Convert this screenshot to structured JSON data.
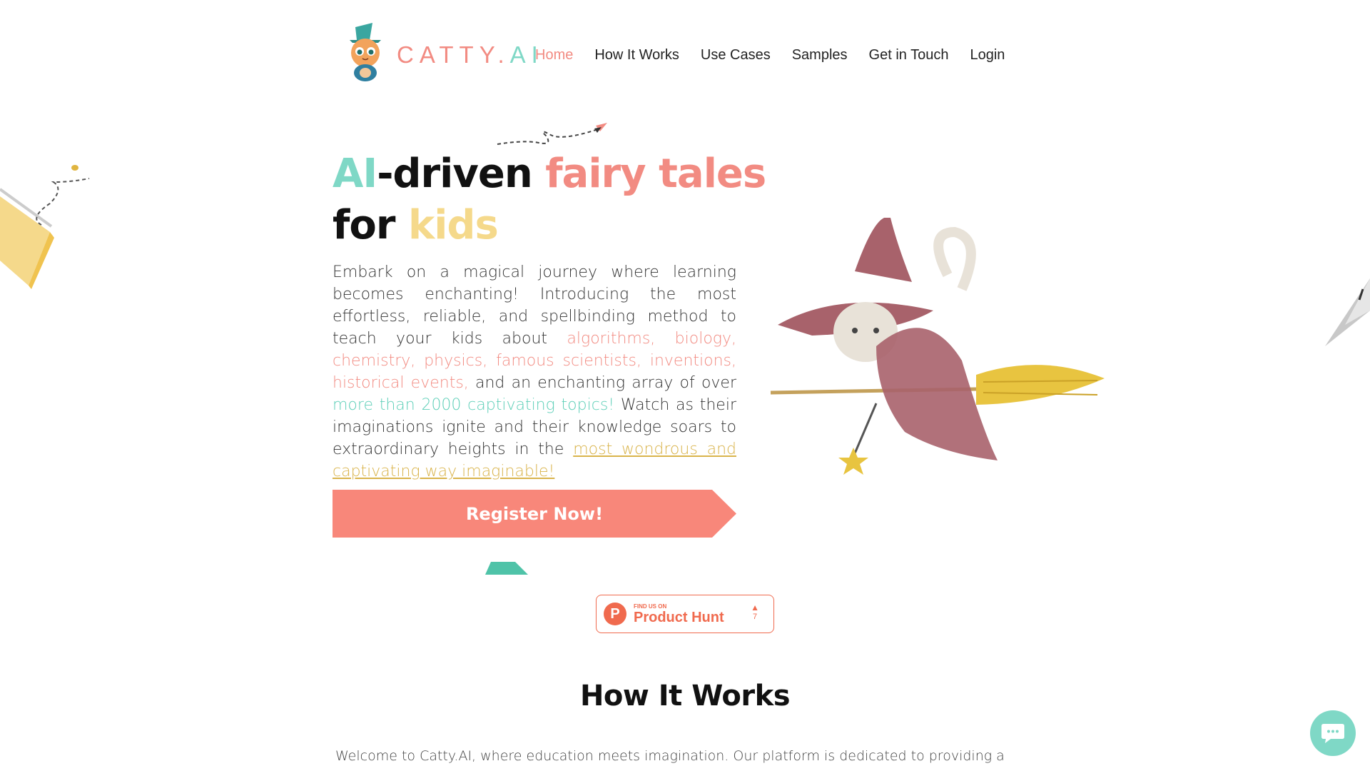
{
  "header": {
    "brand_main": "CATTY.",
    "brand_ai": "AI",
    "nav": [
      {
        "label": "Home",
        "active": true
      },
      {
        "label": "How It Works",
        "active": false
      },
      {
        "label": "Use Cases",
        "active": false
      },
      {
        "label": "Samples",
        "active": false
      },
      {
        "label": "Get in Touch",
        "active": false
      },
      {
        "label": "Login",
        "active": false
      }
    ]
  },
  "hero": {
    "title_ai": "AI",
    "title_driven": "-driven ",
    "title_fairy": "fairy tales",
    "title_for": "for ",
    "title_kids": "kids",
    "text_intro": "Embark on a magical journey where learning becomes enchanting! Introducing the most effortless, reliable, and spellbinding method to teach your kids about ",
    "text_topics": "algorithms, biology, chemistry, physics, famous scientists, inventions, historical events,",
    "text_middle": " and an enchanting array of over ",
    "text_count": "more than 2000 captivating topics!",
    "text_after": " Watch as their imaginations ignite and their knowledge soars to extraordinary heights in the ",
    "text_link": "most wondrous and captivating way imaginable!",
    "register_label": "Register Now!"
  },
  "product_hunt": {
    "small": "FIND US ON",
    "big": "Product Hunt",
    "logo_letter": "P",
    "arrow": "▲",
    "votes": "7"
  },
  "how_it_works": {
    "title": "How It Works",
    "text": "Welcome to Catty.AI, where education meets imagination. Our platform is dedicated to providing a"
  },
  "icons": {
    "chat": "chat-bubble-icon"
  },
  "colors": {
    "teal": "#7fd8c6",
    "coral": "#f28b82",
    "yellow": "#f5d98b",
    "gold": "#d9b34a",
    "product_hunt": "#f06a4e"
  }
}
